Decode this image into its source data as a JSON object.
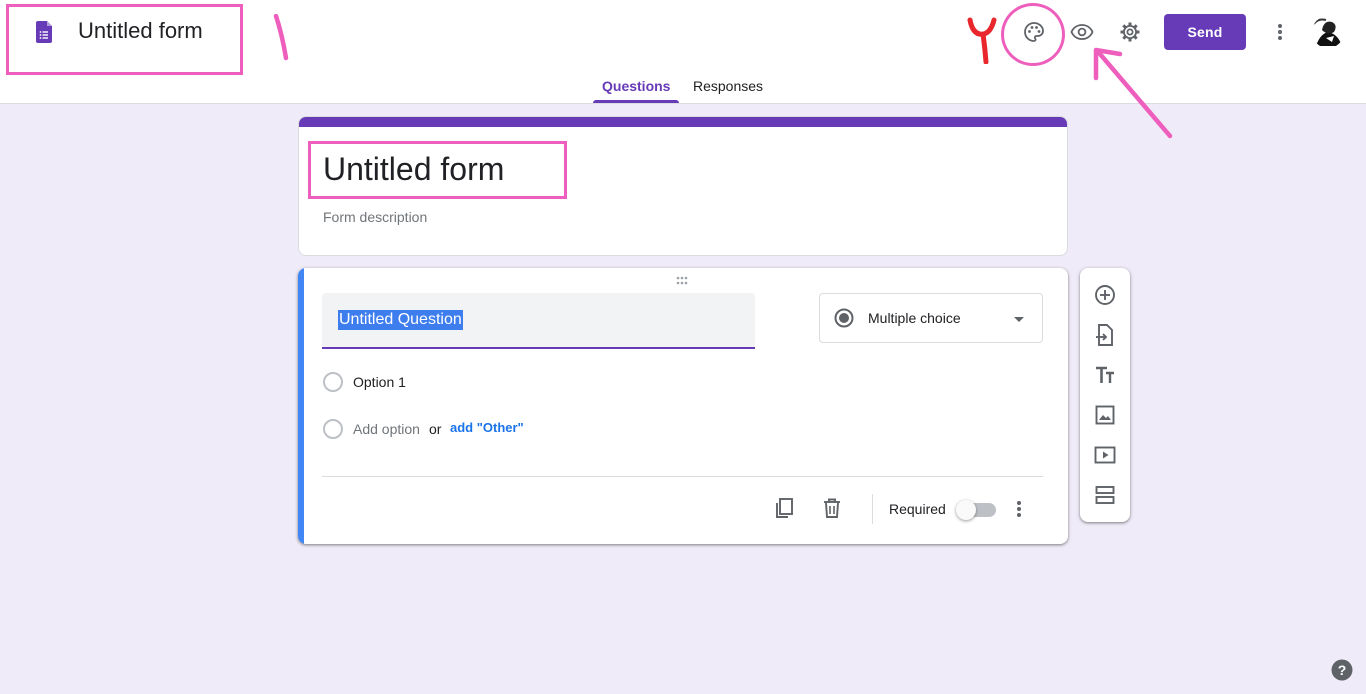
{
  "header": {
    "app_title": "Untitled form",
    "send_label": "Send"
  },
  "tabs": [
    {
      "label": "Questions",
      "active": true
    },
    {
      "label": "Responses",
      "active": false
    }
  ],
  "form": {
    "title": "Untitled form",
    "description_placeholder": "Form description"
  },
  "question": {
    "title": "Untitled Question",
    "type": "Multiple choice",
    "options": [
      "Option 1"
    ],
    "add_option": "Add option",
    "or": "or",
    "add_other": "add \"Other\"",
    "required_label": "Required",
    "required": false
  },
  "annotations": {
    "label_1": "١",
    "label_2": "٢"
  },
  "colors": {
    "accent": "#673ab7",
    "background": "#f0ebf8",
    "active_question_bar": "#4285f4",
    "annotation": "#ee5fbd",
    "annotation_number_2": "#e8262b"
  },
  "icons": {
    "doc": "forms-doc-icon",
    "palette": "palette-icon",
    "preview": "eye-icon",
    "settings": "gear-icon",
    "more": "more-vert-icon",
    "help": "help-icon"
  }
}
